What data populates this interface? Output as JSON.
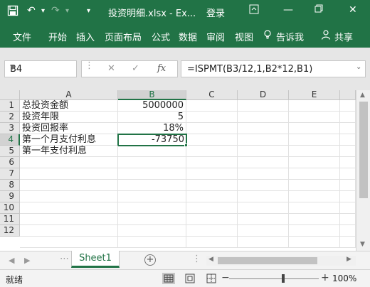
{
  "window": {
    "title": "投资明细.xlsx - Ex...",
    "login": "登录"
  },
  "ribbon": {
    "tabs": [
      "文件",
      "开始",
      "插入",
      "页面布局",
      "公式",
      "数据",
      "审阅",
      "视图"
    ],
    "tell_me": "告诉我",
    "share": "共享"
  },
  "namebox": {
    "value": "B4"
  },
  "formula_bar": {
    "fx_label": "fx",
    "formula": "=ISPMT(B3/12,1,B2*12,B1)"
  },
  "grid": {
    "columns": [
      "A",
      "B",
      "C",
      "D",
      "E"
    ],
    "rows": [
      "1",
      "2",
      "3",
      "4",
      "5",
      "6",
      "7",
      "8",
      "9",
      "10",
      "11",
      "12"
    ],
    "active_cell": "B4",
    "cells": {
      "A1": "总投资金额",
      "B1": "5000000",
      "A2": "投资年限",
      "B2": "5",
      "A3": "投资回报率",
      "B3": "18%",
      "A4": "第一个月支付利息",
      "B4": "-73750",
      "A5": "第一年支付利息"
    }
  },
  "sheets": {
    "tabs": [
      "Sheet1"
    ],
    "active": "Sheet1"
  },
  "status": {
    "mode": "就绪",
    "zoom": "100%"
  },
  "colors": {
    "accent": "#217346"
  }
}
